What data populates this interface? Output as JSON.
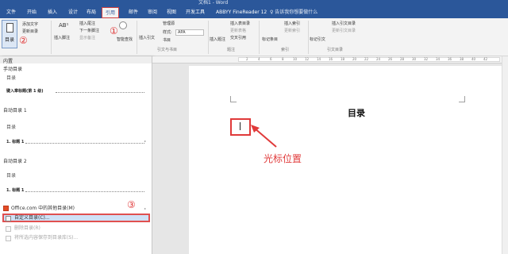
{
  "titlebar": {
    "text": "文档1 - Word",
    "text2": ""
  },
  "tabs": [
    {
      "label": "文件"
    },
    {
      "label": "开始"
    },
    {
      "label": "插入"
    },
    {
      "label": "设计"
    },
    {
      "label": "布局"
    },
    {
      "label": "引用"
    },
    {
      "label": "邮件"
    },
    {
      "label": "审阅"
    },
    {
      "label": "视图"
    },
    {
      "label": "开发工具"
    },
    {
      "label": "ABBYY FineReader 12"
    }
  ],
  "tell_me": "♀ 告诉我你想要做什么",
  "ribbon": {
    "toc_label": "目录",
    "add_text": "添加文字",
    "update_toc": "更新目录",
    "ab_icon": "AB¹",
    "insert_footnote": "插入脚注",
    "insert_endnote": "插入尾注",
    "next_footnote": "下一条脚注",
    "show_notes": "显示备注",
    "smart_lookup": "智能查找",
    "insert_citation": "插入引文",
    "manage_sources": "管理源",
    "style_label": "样式:",
    "style_value": "APA",
    "bibliography": "书目",
    "group_citations": "引文与书目",
    "insert_caption": "插入题注",
    "insert_tof": "插入表目录",
    "update_table": "更新表格",
    "cross_ref": "交叉引用",
    "group_captions": "题注",
    "mark_entry": "标记条目",
    "insert_index": "插入索引",
    "update_index": "更新索引",
    "group_index": "索引",
    "mark_citation": "标记引文",
    "insert_toa": "插入引文目录",
    "update_toa": "更新引文目录",
    "group_toa": "引文目录"
  },
  "badges": {
    "one": "①",
    "two": "②",
    "three": "③"
  },
  "panel": {
    "built_in": "内置",
    "manual_toc": "手动目录",
    "manual_heading": "目录",
    "manual_entry": "键入章标题(第 1 级)",
    "auto_toc1": "自动目录 1",
    "auto1_heading": "目录",
    "auto1_entry": "1. 标题 1",
    "auto_toc2": "自动目录 2",
    "auto2_heading": "目录",
    "auto2_entry": "1. 标题 1",
    "office_more": "Office.com 中的其他目录(M)",
    "custom_toc": "自定义目录(C)...",
    "remove_toc": "删除目录(R)",
    "save_selection": "将所选内容保存到目录库(S)..."
  },
  "ruler": {
    "labels": [
      "2",
      "4",
      "6",
      "8",
      "10",
      "12",
      "14",
      "16",
      "18",
      "20",
      "22",
      "24",
      "26",
      "28",
      "30",
      "32",
      "34",
      "36",
      "38",
      "40",
      "42"
    ]
  },
  "document": {
    "title": "目录",
    "annotation": "光标位置"
  }
}
